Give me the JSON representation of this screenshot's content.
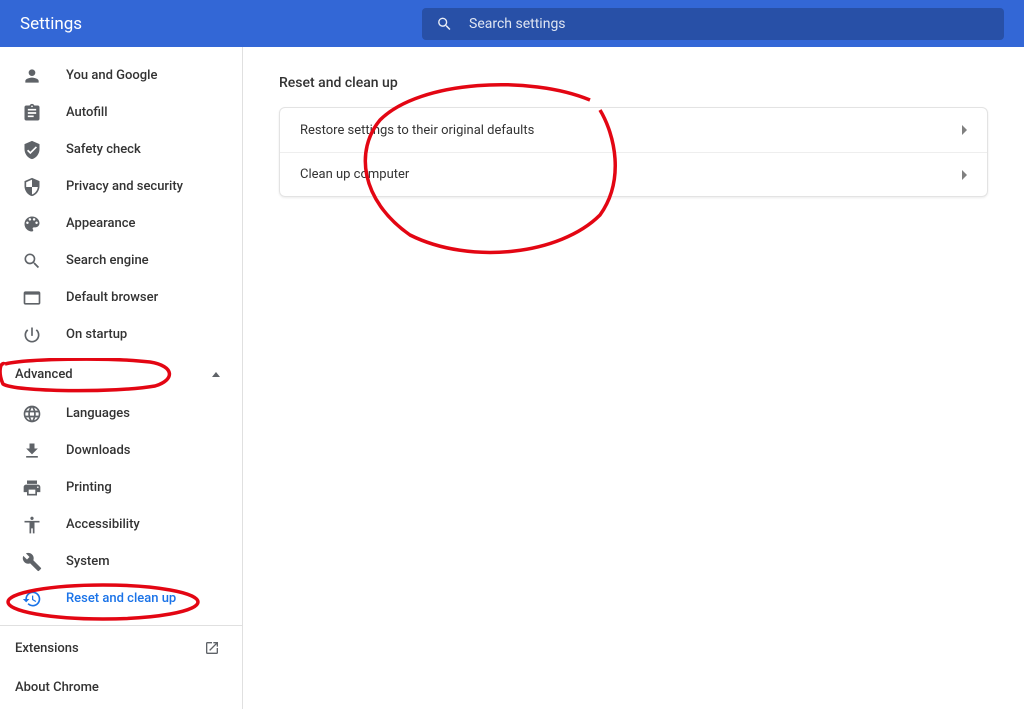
{
  "header": {
    "title": "Settings",
    "search_placeholder": "Search settings"
  },
  "sidebar": {
    "items": [
      {
        "label": "You and Google"
      },
      {
        "label": "Autofill"
      },
      {
        "label": "Safety check"
      },
      {
        "label": "Privacy and security"
      },
      {
        "label": "Appearance"
      },
      {
        "label": "Search engine"
      },
      {
        "label": "Default browser"
      },
      {
        "label": "On startup"
      }
    ],
    "advanced_label": "Advanced",
    "advanced_items": [
      {
        "label": "Languages"
      },
      {
        "label": "Downloads"
      },
      {
        "label": "Printing"
      },
      {
        "label": "Accessibility"
      },
      {
        "label": "System"
      },
      {
        "label": "Reset and clean up"
      }
    ],
    "extensions_label": "Extensions",
    "about_label": "About Chrome"
  },
  "main": {
    "section_title": "Reset and clean up",
    "rows": [
      {
        "label": "Restore settings to their original defaults"
      },
      {
        "label": "Clean up computer"
      }
    ]
  }
}
